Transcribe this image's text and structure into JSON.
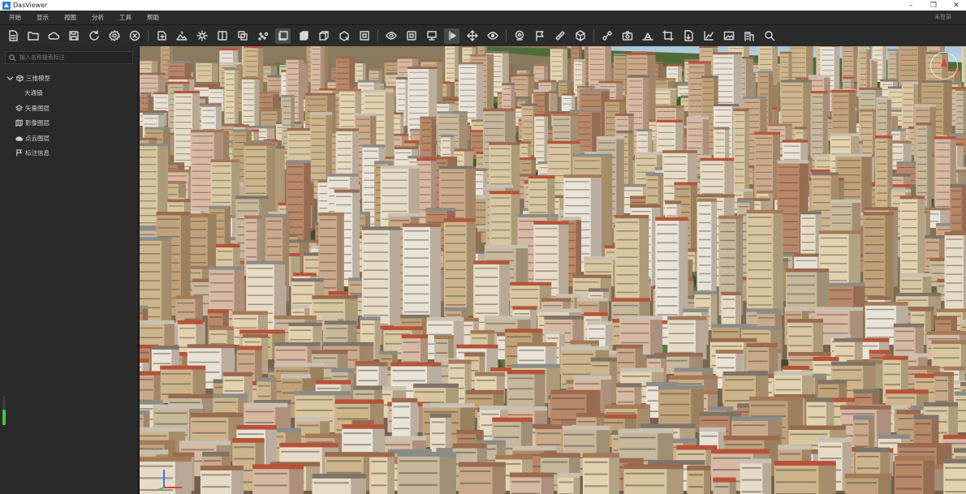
{
  "window": {
    "title": "DasViewer",
    "minimize_glyph": "–",
    "restore_glyph": "❐",
    "close_glyph": "✕"
  },
  "menu": {
    "items": [
      "开始",
      "显示",
      "视图",
      "分析",
      "工具",
      "帮助"
    ],
    "login_label": "未登录"
  },
  "toolbar": {
    "icons": [
      "new-file-icon",
      "open-folder-icon",
      "cloud-icon",
      "save-icon",
      "refresh-icon",
      "settings-icon",
      "close-circle-icon",
      "add-layer-icon",
      "terrain-icon",
      "light-icon",
      "texture-icon",
      "overlay-icon",
      "point-cloud-icon",
      "layers-icon",
      "solid-view-icon",
      "wireframe-icon",
      "clip-icon",
      "fullscreen-icon",
      "view-icon",
      "frame-icon",
      "presentation-icon",
      "cursor-icon",
      "move-icon",
      "eye-icon",
      "location-pin-icon",
      "flag-icon",
      "ruler-icon",
      "cube-icon",
      "link-icon",
      "camera-icon",
      "area-icon",
      "crop-icon",
      "export-icon",
      "chart-icon",
      "image-icon",
      "building-icon",
      "search-icon"
    ],
    "active_icons": [
      "layers-icon",
      "solid-view-icon",
      "cursor-icon"
    ]
  },
  "sidebar": {
    "search_placeholder": "输入名称搜索标注",
    "tree": {
      "root_label": "三维模型",
      "root_child": "大通镇",
      "items": [
        "矢量图层",
        "影像图层",
        "点云图层",
        "标注信息"
      ]
    },
    "level_fraction": 0.55
  },
  "colors": {
    "accent_green": "#45c245",
    "compass_red": "#e23b3b",
    "logo_blue": "#2f7fd8"
  }
}
